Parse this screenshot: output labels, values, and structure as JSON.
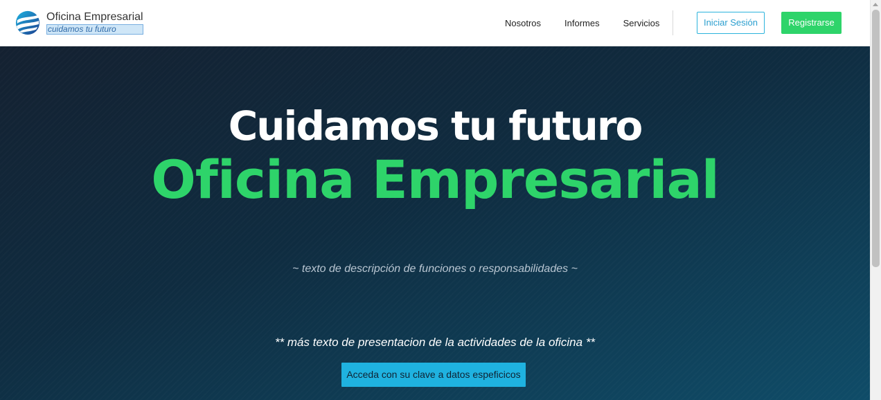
{
  "brand": {
    "title": "Oficina Empresarial",
    "subtitle": "cuidamos tu futuro",
    "logo_icon": "globe-swirl-logo-icon"
  },
  "nav": {
    "links": [
      {
        "label": "Nosotros"
      },
      {
        "label": "Informes"
      },
      {
        "label": "Servicios"
      }
    ],
    "login_label": "Iniciar Sesión",
    "register_label": "Registrarse"
  },
  "hero": {
    "title_line1": "Cuidamos tu futuro",
    "title_line2": "Oficina Empresarial",
    "description": "~ texto de descripción de funciones o responsabilidades ~",
    "more_text": "** más texto de presentacion de la actividades de la oficina **",
    "cta_label": "Acceda con su clave a datos espeficicos"
  },
  "colors": {
    "accent_green": "#2ed46a",
    "accent_blue": "#1fb2e0",
    "hero_dark": "#142131",
    "hero_teal": "#0f4c68"
  }
}
